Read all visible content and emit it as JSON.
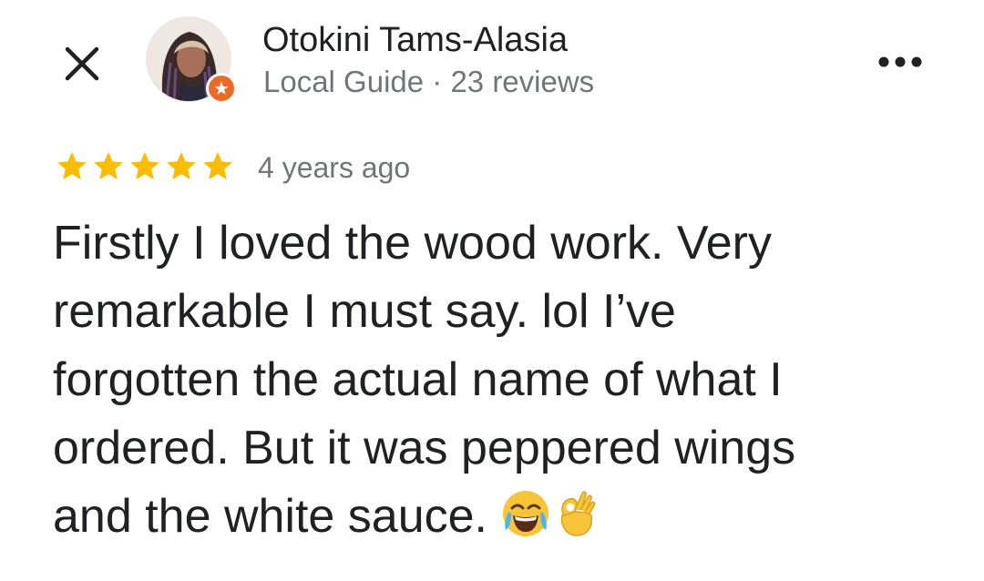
{
  "header": {
    "close_icon": "close-icon",
    "more_icon": "more-horizontal-icon",
    "author": {
      "name": "Otokini Tams-Alasia",
      "meta": "Local Guide · 23 reviews",
      "badge_icon": "local-guide-star-icon",
      "badge_color": "#ea6a2a"
    }
  },
  "review": {
    "rating": 5,
    "max_rating": 5,
    "star_color": "#fbbc04",
    "time": "4 years ago",
    "lines": [
      "Firstly I loved the wood work. Very",
      "remarkable I must say. lol I’ve",
      "forgotten the actual name of what I",
      "ordered. But it was peppered wings",
      "and the white sauce."
    ],
    "emojis": [
      "face-with-tears-of-joy-icon",
      "ok-hand-icon"
    ]
  }
}
